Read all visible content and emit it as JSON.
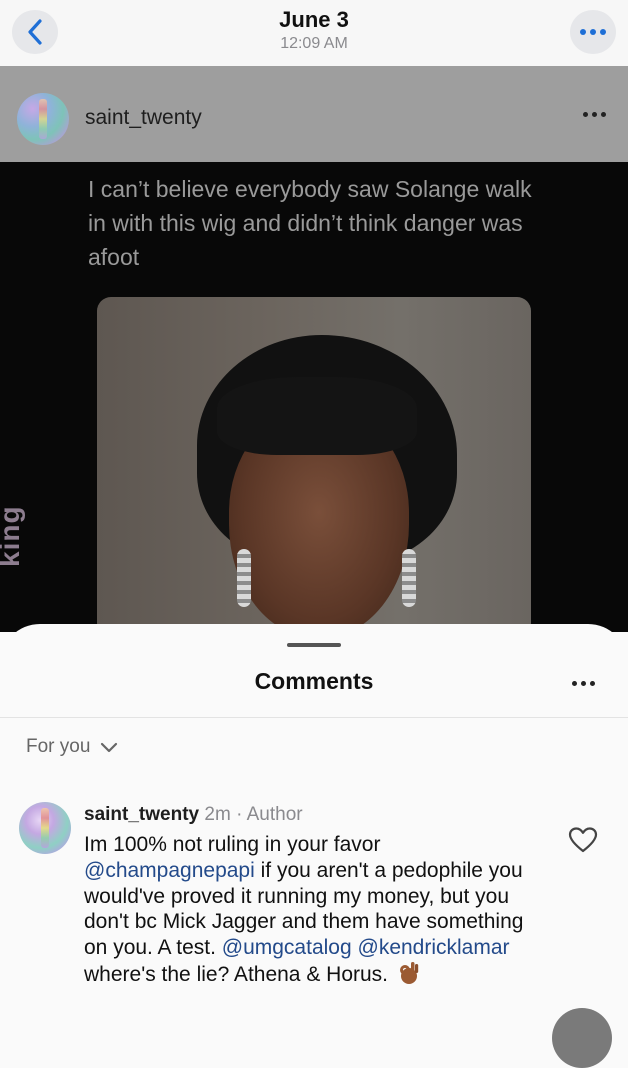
{
  "nav": {
    "date": "June 3",
    "time": "12:09 AM"
  },
  "post": {
    "username": "saint_twenty",
    "tweet_text": "I can’t believe everybody saw Solange walk in with this wig and didn’t think danger was afoot",
    "side_watermark": "king"
  },
  "comments_sheet": {
    "title": "Comments",
    "filter_label": "For you"
  },
  "comment": {
    "username": "saint_twenty",
    "time": "2m",
    "separator": "·",
    "author_badge": "Author",
    "text_1": "Im 100% not ruling in your favor ",
    "mention_1": "@champagnepapi",
    "text_2": " if you aren't a pedophile you would've proved it running my money, but you don't bc Mick Jagger and them have something on you. A test. ",
    "mention_2": "@umgcatalog",
    "text_3": " ",
    "mention_3": "@kendricklamar",
    "text_4": " where's the lie? Athena & Horus.",
    "emoji": "ok-hand-emoji"
  },
  "colors": {
    "accent_blue": "#1f6fd6",
    "mention_blue": "#234a8a",
    "muted_gray": "#8a8a8e"
  }
}
